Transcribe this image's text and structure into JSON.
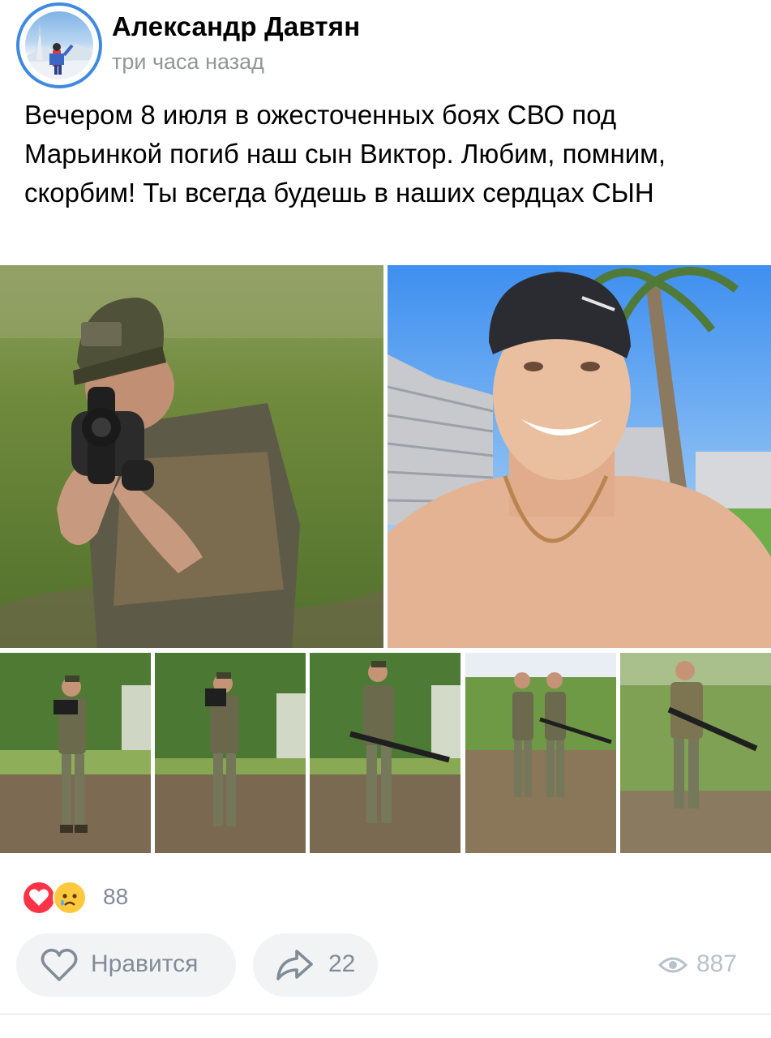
{
  "post": {
    "author": "Александр Давтян",
    "time": "три часа назад",
    "text": "Вечером 8 июля в ожесточенных боях СВО под Марьинкой погиб наш сын Виктор. Любим, помним, скорбим! Ты всегда будешь в наших сердцах СЫН"
  },
  "reactions": {
    "icons": [
      "heart-reaction-icon",
      "crying-face-reaction-icon"
    ],
    "count": "88"
  },
  "actions": {
    "like_label": "Нравится",
    "share_count": "22",
    "views_count": "887"
  },
  "colors": {
    "accent": "#3f8ae0",
    "secondary_text": "#818c99",
    "button_bg": "#f2f3f5",
    "heart": "#ff3347"
  }
}
